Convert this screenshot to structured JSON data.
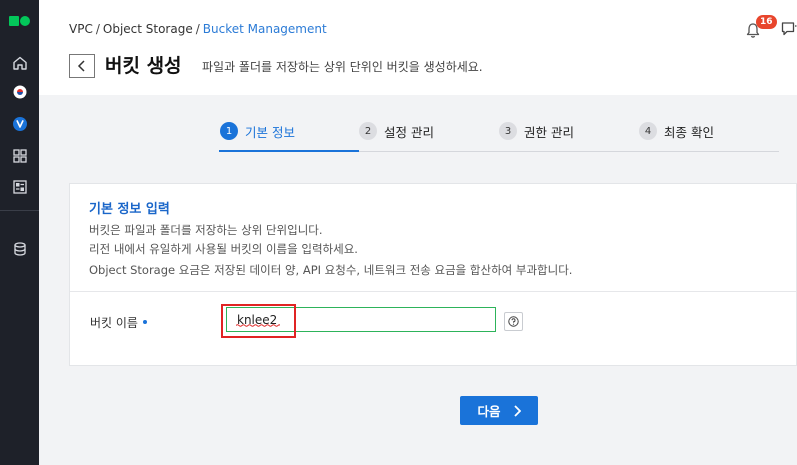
{
  "breadcrumb": {
    "items": [
      "VPC",
      "Object Storage"
    ],
    "separator": "/",
    "current": "Bucket Management"
  },
  "header": {
    "title": "버킷 생성",
    "description": "파일과 폴더를 저장하는 상위 단위인 버킷을 생성하세요.",
    "notification_count": "16"
  },
  "steps": [
    {
      "num": "1",
      "label": "기본 정보",
      "active": true
    },
    {
      "num": "2",
      "label": "설정 관리",
      "active": false
    },
    {
      "num": "3",
      "label": "권한 관리",
      "active": false
    },
    {
      "num": "4",
      "label": "최종 확인",
      "active": false
    }
  ],
  "card": {
    "title": "기본 정보 입력",
    "lines": [
      "버킷은 파일과 폴더를 저장하는 상위 단위입니다.",
      "리전 내에서 유일하게 사용될 버킷의 이름을 입력하세요.",
      "Object Storage 요금은 저장된 데이터 양, API 요청수, 네트워크 전송 요금을 합산하여 부과합니다."
    ],
    "field_label": "버킷 이름",
    "field_value": "knlee2"
  },
  "next_button": {
    "label": "다음"
  },
  "sidebar": {
    "items": [
      "home-icon",
      "region-kr-icon",
      "vpc-icon",
      "grid-icon",
      "dashboard-icon",
      "database-icon"
    ]
  },
  "colors": {
    "primary": "#1a73d9",
    "sidebar_bg": "#1e2129",
    "brand_green": "#03c75a",
    "highlight_red": "#e02424",
    "input_border": "#2db35a"
  }
}
